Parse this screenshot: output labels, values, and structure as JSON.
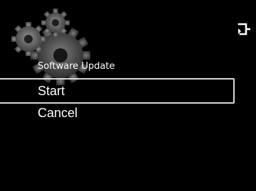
{
  "menu": {
    "title": "Software Update",
    "items": [
      {
        "label": "Start",
        "selected": true
      },
      {
        "label": "Cancel",
        "selected": false
      }
    ]
  },
  "icons": {
    "background": "gears-icon",
    "top_right": "return-icon"
  },
  "colors": {
    "background": "#000000",
    "text": "#ffffff",
    "selection_border": "#d8d8d8",
    "gear_fill": "#7a7a7a"
  }
}
